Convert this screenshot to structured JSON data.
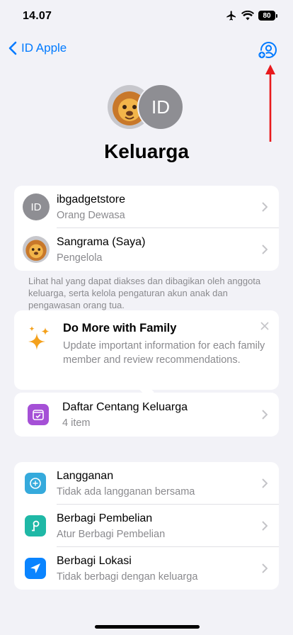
{
  "status": {
    "time": "14.07",
    "battery": "80"
  },
  "nav": {
    "back_label": "ID Apple"
  },
  "avatars": {
    "initials": "ID"
  },
  "page": {
    "title": "Keluarga"
  },
  "members": [
    {
      "initials": "ID",
      "name": "ibgadgetstore",
      "role": "Orang Dewasa"
    },
    {
      "name": "Sangrama (Saya)",
      "role": "Pengelola"
    }
  ],
  "footnote": "Lihat hal yang dapat diakses dan dibagikan oleh anggota keluarga, serta kelola pengaturan akun anak dan pengawasan orang tua.",
  "promo": {
    "title": "Do More with Family",
    "body": "Update important information for each family member and review recommendations."
  },
  "checklist": {
    "title": "Daftar Centang Keluarga",
    "sub": "4 item",
    "icon_color": "#a550d6"
  },
  "services": [
    {
      "title": "Langganan",
      "sub": "Tidak ada langganan bersama",
      "icon": "subscription-icon",
      "color": "#35aadc"
    },
    {
      "title": "Berbagi Pembelian",
      "sub": "Atur Berbagi Pembelian",
      "icon": "purchase-sharing-icon",
      "color": "#1fb8a6"
    },
    {
      "title": "Berbagi Lokasi",
      "sub": "Tidak berbagi dengan keluarga",
      "icon": "location-arrow-icon",
      "color": "#0a84ff"
    }
  ],
  "colors": {
    "accent": "#007aff",
    "annotation_arrow": "#e8191c"
  }
}
